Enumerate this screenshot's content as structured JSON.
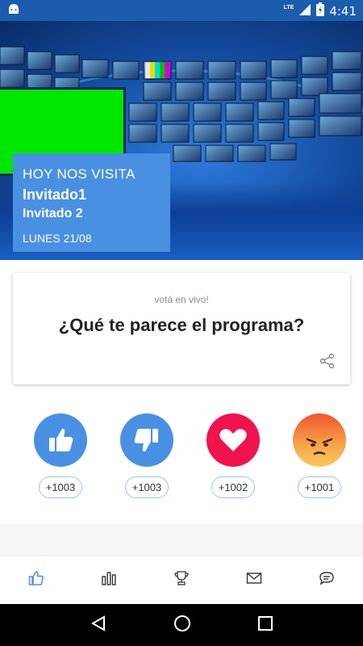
{
  "status_bar": {
    "time": "4:41",
    "network": "LTE",
    "icons": [
      "android-icon",
      "signal-icon",
      "battery-icon"
    ]
  },
  "hero": {
    "line1": "HOY NOS VISITA",
    "guest1": "Invitado1",
    "guest2": "Invitado 2",
    "date": "LUNES 21/08"
  },
  "poll": {
    "subtitle": "votá en vivo!",
    "question": "¿Qué te parece el programa?"
  },
  "reactions": [
    {
      "icon": "thumbs-up-icon",
      "count": "+1003",
      "color": "#4a90e2"
    },
    {
      "icon": "thumbs-down-icon",
      "count": "+1003",
      "color": "#4a90e2"
    },
    {
      "icon": "heart-icon",
      "count": "+1002",
      "color": "#f0134d"
    },
    {
      "icon": "angry-face-icon",
      "count": "+1001",
      "color": "#f08a2e"
    }
  ],
  "tabs": [
    "tab-like",
    "tab-stats",
    "tab-trophy",
    "tab-mail",
    "tab-chat"
  ],
  "colors": {
    "status_bar": "#1b5cad",
    "accent": "#4a90e2",
    "heart": "#f0134d"
  }
}
